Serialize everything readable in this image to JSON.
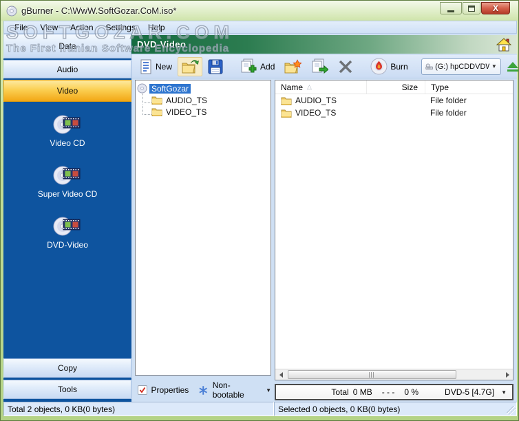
{
  "window": {
    "title": "gBurner - C:\\WwW.SoftGozar.CoM.iso*"
  },
  "watermark": {
    "line1": "SOFTGOZAR.COM",
    "line2": "The First Iranian Software Encyclopedia"
  },
  "menu": {
    "items": [
      "File",
      "View",
      "Action",
      "Settings",
      "Help"
    ]
  },
  "sidebar": {
    "data_label": "Data",
    "audio_label": "Audio",
    "video_label": "Video",
    "video_items": [
      "Video CD",
      "Super Video CD",
      "DVD-Video"
    ],
    "copy_label": "Copy",
    "tools_label": "Tools"
  },
  "main": {
    "header_title": "DVD-Video"
  },
  "toolbar": {
    "new_label": "New",
    "add_label": "Add",
    "burn_label": "Burn",
    "drive_value": "(G:) hpCDDVDW TS-"
  },
  "tree": {
    "root_label": "SoftGozar",
    "children": [
      "AUDIO_TS",
      "VIDEO_TS"
    ]
  },
  "file_list": {
    "columns": [
      "Name",
      "Size",
      "Type"
    ],
    "rows": [
      {
        "name": "AUDIO_TS",
        "size": "",
        "type": "File folder"
      },
      {
        "name": "VIDEO_TS",
        "size": "",
        "type": "File folder"
      }
    ]
  },
  "footer": {
    "properties_label": "Properties",
    "boot_mode": "Non-bootable",
    "total_label": "Total",
    "total_size": "0 MB",
    "dashes": "- - -",
    "percent": "0 %",
    "disc_type": "DVD-5 [4.7G]"
  },
  "statusbar": {
    "left": "Total 2 objects, 0 KB(0 bytes)",
    "right": "Selected 0 objects, 0 KB(0 bytes)"
  },
  "glyphs": {
    "close": "X",
    "dropdown": "▼",
    "sort": "△"
  },
  "colors": {
    "sidebar_blue": "#0E549F",
    "selected_orange": "#F2A715",
    "header_green": "#156B40",
    "selection_blue": "#2E75CF",
    "close_red": "#D4604B"
  }
}
